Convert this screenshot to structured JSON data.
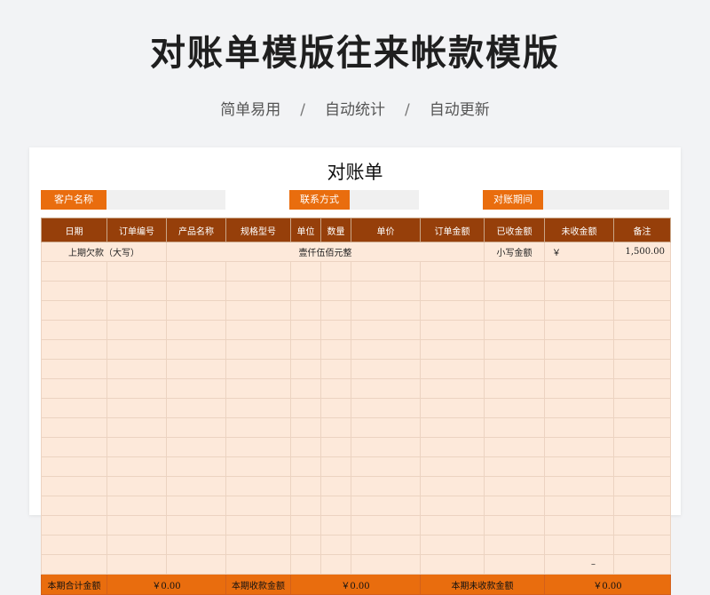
{
  "page": {
    "title": "对账单模版往来帐款模版",
    "tags": [
      "简单易用",
      "自动统计",
      "自动更新"
    ],
    "separator": "/"
  },
  "sheet": {
    "title": "对账单",
    "info": {
      "customer_label": "客户名称",
      "contact_label": "联系方式",
      "period_label": "对账期间"
    },
    "columns": [
      "日期",
      "订单编号",
      "产品名称",
      "规格型号",
      "单位",
      "数量",
      "单价",
      "订单金额",
      "已收金额",
      "未收金额",
      "备注"
    ],
    "prev_row": {
      "label": "上期欠款（大写）",
      "amount_words": "壹仟伍佰元整",
      "small_label": "小写金额",
      "currency": "￥",
      "amount": "1,500.00"
    },
    "empty_row_mark": "–",
    "totals": {
      "total_label": "本期合计金额",
      "total_value": "￥0.00",
      "received_label": "本期收款金额",
      "received_value": "￥0.00",
      "unreceived_label": "本期未收款金额",
      "unreceived_value": "￥0.00"
    }
  }
}
